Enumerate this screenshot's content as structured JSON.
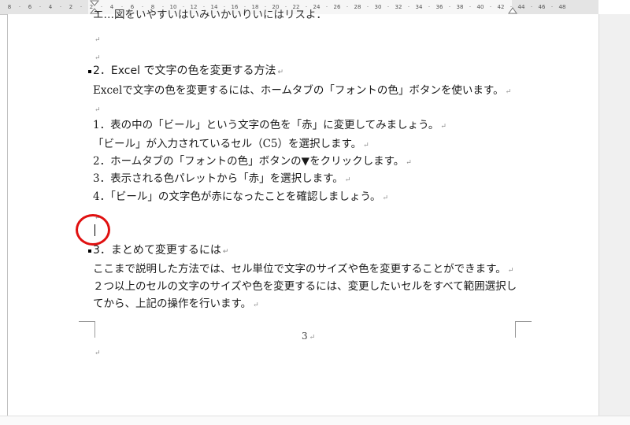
{
  "ruler": {
    "labels": [
      "8",
      "6",
      "4",
      "2",
      "2",
      "4",
      "6",
      "8",
      "10",
      "12",
      "14",
      "16",
      "18",
      "20",
      "22",
      "24",
      "26",
      "28",
      "30",
      "32",
      "34",
      "36",
      "38",
      "40",
      "42",
      "44",
      "46",
      "48"
    ]
  },
  "document": {
    "partial_top_line": "エ…図をいやすいはいみいかいりいにはリスよ．",
    "return_mark": "↵",
    "section2_heading": "2．Excel で文字の色を変更する方法",
    "section2_intro": "Excelで文字の色を変更するには、ホームタブの「フォントの色」ボタンを使います。",
    "step1": "1．表の中の「ビール」という文字の色を「赤」に変更してみましょう。",
    "step1_note": "「ビール」が入力されているセル（C5）を選択します。",
    "step2": "2．ホームタブの「フォントの色」ボタンの▼をクリックします。",
    "step3": "3．表示される色パレットから「赤」を選択します。",
    "step4": "4．「ビール」の文字色が赤になったことを確認しましょう。",
    "section3_heading": "3．まとめて変更するには",
    "section3_line1": "ここまで説明した方法では、セル単位で文字のサイズや色を変更することができます。",
    "section3_line2": "２つ以上のセルの文字のサイズや色を変更するには、変更したいセルをすべて範囲選択し",
    "section3_line3": "てから、上記の操作を行います。",
    "page_number": "3"
  },
  "colors": {
    "annotation_circle": "#e01010",
    "ruler_bg": "#e4e4e4"
  }
}
